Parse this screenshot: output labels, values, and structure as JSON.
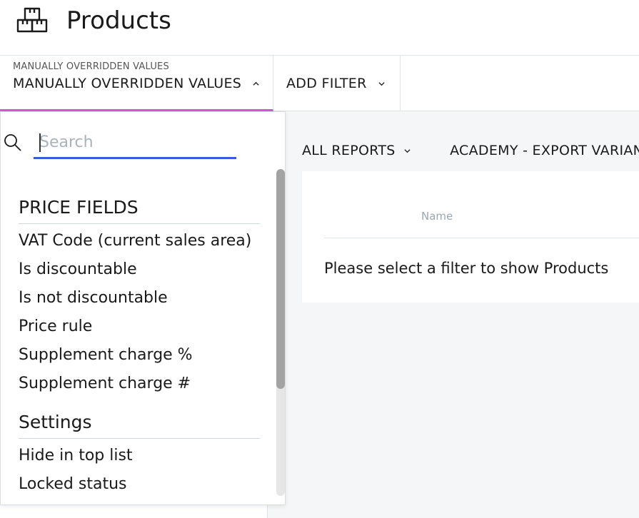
{
  "header": {
    "title": "Products",
    "icon": "boxes-icon"
  },
  "filterbar": {
    "active_filter": {
      "caption": "MANUALLY OVERRIDDEN VALUES",
      "value": "MANUALLY OVERRIDDEN VALUES",
      "icon": "chevron-up-icon"
    },
    "add_filter": {
      "label": "ADD FILTER",
      "icon": "chevron-down-icon"
    },
    "accent_color": "#e04fd9"
  },
  "dropdown": {
    "search": {
      "placeholder": "Search",
      "value": ""
    },
    "groups": [
      {
        "title": "PRICE FIELDS",
        "items": [
          "VAT Code (current sales area)",
          "Is discountable",
          "Is not discountable",
          "Price rule",
          "Supplement charge %",
          "Supplement charge #"
        ]
      },
      {
        "title": "Settings",
        "items": [
          "Hide in top list",
          "Locked status"
        ]
      }
    ]
  },
  "main": {
    "reports": [
      {
        "label": "ALL REPORTS"
      },
      {
        "label": "ACADEMY - EXPORT VARIANTS"
      }
    ],
    "table": {
      "column_name": "Name",
      "empty_message": "Please select a filter to show Products"
    }
  }
}
